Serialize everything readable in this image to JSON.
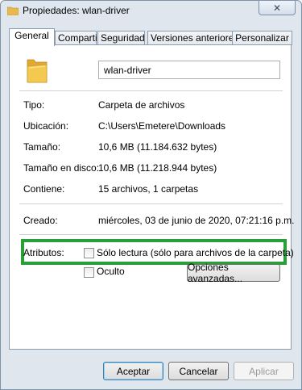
{
  "window": {
    "title": "Propiedades: wlan-driver",
    "close_glyph": "✕"
  },
  "tabs": [
    {
      "label": "General",
      "active": true
    },
    {
      "label": "Compartir",
      "active": false
    },
    {
      "label": "Seguridad",
      "active": false
    },
    {
      "label": "Versiones anteriores",
      "active": false
    },
    {
      "label": "Personalizar",
      "active": false
    }
  ],
  "general": {
    "folder_name": "wlan-driver",
    "icon": "folder-icon",
    "fields": [
      {
        "label": "Tipo:",
        "value": "Carpeta de archivos"
      },
      {
        "label": "Ubicación:",
        "value": "C:\\Users\\Emetere\\Downloads"
      },
      {
        "label": "Tamaño:",
        "value": "10,6 MB (11.184.632 bytes)"
      },
      {
        "label": "Tamaño en disco:",
        "value": "10,6 MB (11.218.944 bytes)"
      },
      {
        "label": "Contiene:",
        "value": "15 archivos, 1 carpetas"
      }
    ],
    "created": {
      "label": "Creado:",
      "value": "miércoles, 03 de junio de 2020, 07:21:16 p.m."
    },
    "attributes": {
      "label": "Atributos:",
      "read_only": {
        "label": "Sólo lectura (sólo para archivos de la carpeta)",
        "checked": false
      },
      "hidden": {
        "label": "Oculto",
        "checked": false
      },
      "advanced_button": "Opciones avanzadas..."
    }
  },
  "buttons": {
    "ok": "Aceptar",
    "cancel": "Cancelar",
    "apply": "Aplicar"
  },
  "colors": {
    "highlight": "#27a038",
    "folder": "#f3c94f"
  }
}
